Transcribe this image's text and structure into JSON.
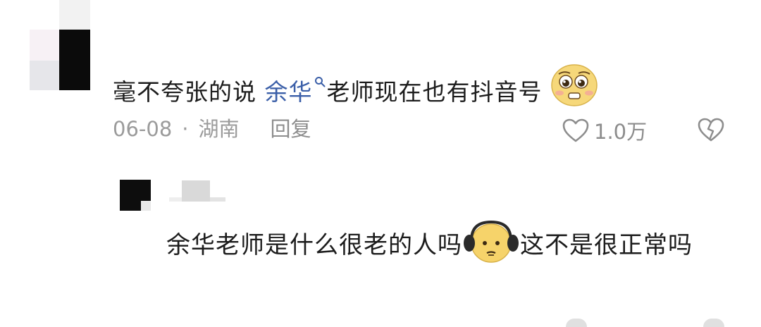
{
  "comment": {
    "text_before": "毫不夸张的说 ",
    "mention": "余华",
    "text_after": "老师现在也有抖音号",
    "emoji": "pleading-face",
    "date": "06-08",
    "separator": "·",
    "location": "湖南",
    "reply_label": "回复",
    "like_count": "1.0万"
  },
  "reply": {
    "text_before": "余华老师是什么很老的人吗",
    "emoji": "headphones-face",
    "text_after": "这不是很正常吗"
  },
  "colors": {
    "text": "#1c1c1c",
    "meta": "#9b9b9b",
    "mention": "#3b5fa8"
  }
}
